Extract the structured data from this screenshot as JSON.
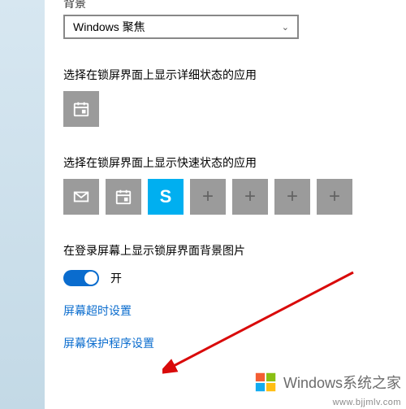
{
  "background": {
    "label": "背景",
    "dropdown_value": "Windows 聚焦"
  },
  "detailed_status": {
    "label": "选择在锁屏界面上显示详细状态的应用",
    "tile_icon": "calendar-icon"
  },
  "quick_status": {
    "label": "选择在锁屏界面上显示快速状态的应用",
    "tiles": [
      {
        "icon": "mail-icon"
      },
      {
        "icon": "calendar-icon"
      },
      {
        "icon": "skype-icon",
        "glyph": "S"
      },
      {
        "icon": "plus-icon",
        "glyph": "+"
      },
      {
        "icon": "plus-icon",
        "glyph": "+"
      },
      {
        "icon": "plus-icon",
        "glyph": "+"
      },
      {
        "icon": "plus-icon",
        "glyph": "+"
      }
    ]
  },
  "show_bg": {
    "label": "在登录屏幕上显示锁屏界面背景图片",
    "state_text": "开",
    "on": true
  },
  "links": {
    "timeout": "屏幕超时设置",
    "screensaver": "屏幕保护程序设置"
  },
  "watermark": {
    "text": "Windows系统之家",
    "url": "www.bjjmlv.com"
  }
}
